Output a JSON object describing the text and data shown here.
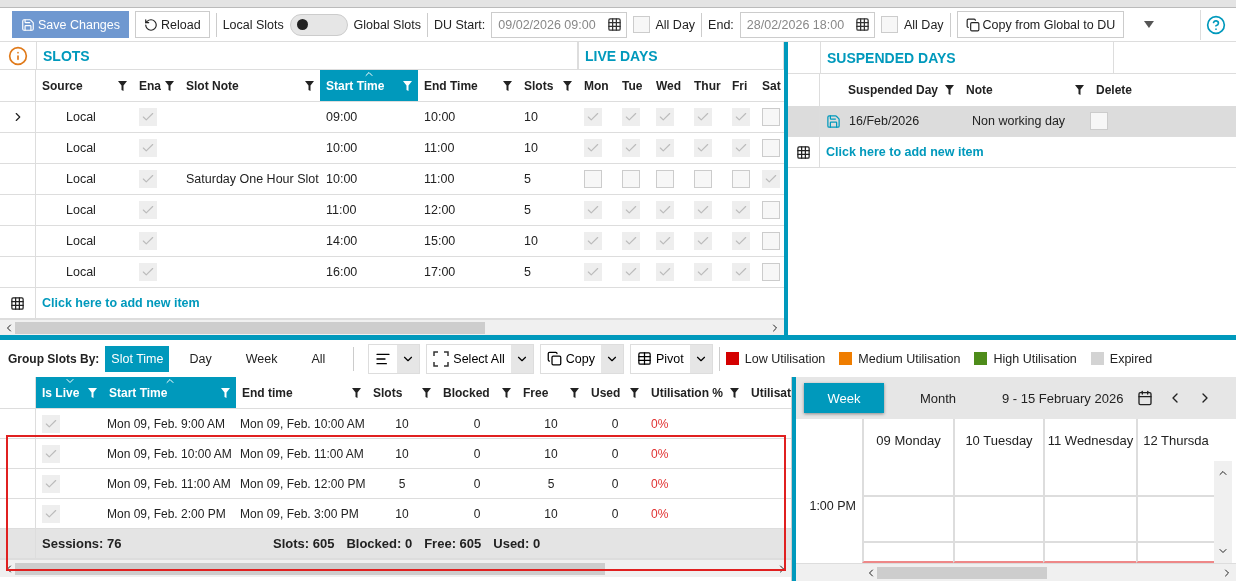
{
  "toolbar": {
    "save_button": "Save Changes",
    "reload_button": "Reload",
    "mode_toggle": {
      "left_label": "Local Slots",
      "right_label": "Global Slots",
      "on": false
    },
    "du_start": {
      "label": "DU Start:",
      "value": "09/02/2026 09:00"
    },
    "start_all_day": {
      "label": "All Day",
      "checked": false
    },
    "end": {
      "label": "End:",
      "value": "28/02/2026 18:00"
    },
    "end_all_day": {
      "label": "All Day",
      "checked": false
    },
    "copy_button": "Copy from Global to DU"
  },
  "slots": {
    "title": "SLOTS",
    "live_days_title": "LIVE DAYS",
    "columns": [
      {
        "label": "Source",
        "filter": true,
        "sorted": false
      },
      {
        "label": "Ena",
        "filter": true,
        "sorted": false
      },
      {
        "label": "Slot Note",
        "filter": true,
        "sorted": false
      },
      {
        "label": "Start Time",
        "filter": true,
        "sorted": true
      },
      {
        "label": "End Time",
        "filter": true,
        "sorted": false
      },
      {
        "label": "Slots",
        "filter": true,
        "sorted": false
      },
      {
        "label": "Mon",
        "sorted": false
      },
      {
        "label": "Tue",
        "sorted": false
      },
      {
        "label": "Wed",
        "sorted": false
      },
      {
        "label": "Thur",
        "sorted": false
      },
      {
        "label": "Fri",
        "sorted": false
      },
      {
        "label": "Sat",
        "sorted": false
      }
    ],
    "rows": [
      {
        "selected": true,
        "source": "Local",
        "enabled": true,
        "note": "",
        "start": "09:00",
        "end": "10:00",
        "slots": "10",
        "days": [
          true,
          true,
          true,
          true,
          true,
          false
        ]
      },
      {
        "selected": false,
        "source": "Local",
        "enabled": true,
        "note": "",
        "start": "10:00",
        "end": "11:00",
        "slots": "10",
        "days": [
          true,
          true,
          true,
          true,
          true,
          false
        ]
      },
      {
        "selected": false,
        "source": "Local",
        "enabled": true,
        "note": "Saturday One Hour Slot",
        "start": "10:00",
        "end": "11:00",
        "slots": "5",
        "days": [
          false,
          false,
          false,
          false,
          false,
          true
        ]
      },
      {
        "selected": false,
        "source": "Local",
        "enabled": true,
        "note": "",
        "start": "11:00",
        "end": "12:00",
        "slots": "5",
        "days": [
          true,
          true,
          true,
          true,
          true,
          false
        ]
      },
      {
        "selected": false,
        "source": "Local",
        "enabled": true,
        "note": "",
        "start": "14:00",
        "end": "15:00",
        "slots": "10",
        "days": [
          true,
          true,
          true,
          true,
          true,
          false
        ]
      },
      {
        "selected": false,
        "source": "Local",
        "enabled": true,
        "note": "",
        "start": "16:00",
        "end": "17:00",
        "slots": "5",
        "days": [
          true,
          true,
          true,
          true,
          true,
          false
        ]
      }
    ],
    "add_item": "Click here to add new item"
  },
  "suspended": {
    "title": "SUSPENDED DAYS",
    "columns": [
      {
        "label": "Suspended Day",
        "filter": true
      },
      {
        "label": "Note",
        "filter": true
      },
      {
        "label": "Delete",
        "filter": false
      }
    ],
    "rows": [
      {
        "selected": true,
        "day": "16/Feb/2026",
        "note": "Non working day",
        "delete": false
      }
    ],
    "add_item": "Click here to add new item"
  },
  "group_bar": {
    "label": "Group Slots By:",
    "options": [
      {
        "label": "Slot Time",
        "selected": true
      },
      {
        "label": "Day",
        "selected": false
      },
      {
        "label": "Week",
        "selected": false
      },
      {
        "label": "All",
        "selected": false
      }
    ],
    "buttons": [
      {
        "kind": "align"
      },
      {
        "kind": "select",
        "label": "Select All"
      },
      {
        "kind": "copy",
        "label": "Copy"
      },
      {
        "kind": "pivot",
        "label": "Pivot"
      }
    ],
    "legend": [
      {
        "label": "Low Utilisation",
        "color": "#d40000"
      },
      {
        "label": "Medium Utilisation",
        "color": "#ef7d00"
      },
      {
        "label": "High Utilisation",
        "color": "#4e8c1a"
      },
      {
        "label": "Expired",
        "color": "#d3d3d3"
      }
    ]
  },
  "sessions": {
    "columns": [
      {
        "label": "Is Live",
        "filter": true,
        "sorted": true
      },
      {
        "label": "Start Time",
        "filter": true,
        "sorted": true
      },
      {
        "label": "End time",
        "filter": true,
        "sorted": false
      },
      {
        "label": "Slots",
        "filter": true,
        "sorted": false
      },
      {
        "label": "Blocked",
        "filter": true,
        "sorted": false
      },
      {
        "label": "Free",
        "filter": true,
        "sorted": false
      },
      {
        "label": "Used",
        "filter": true,
        "sorted": false
      },
      {
        "label": "Utilisation %",
        "filter": true,
        "sorted": false
      },
      {
        "label": "Utilisat",
        "sorted": false
      }
    ],
    "rows": [
      {
        "live": true,
        "start": "Mon 09, Feb. 9:00 AM",
        "end": "Mon 09, Feb. 10:00 AM",
        "slots": "10",
        "blocked": "0",
        "free": "10",
        "used": "0",
        "utilisation": "0%"
      },
      {
        "live": true,
        "start": "Mon 09, Feb. 10:00 AM",
        "end": "Mon 09, Feb. 11:00 AM",
        "slots": "10",
        "blocked": "0",
        "free": "10",
        "used": "0",
        "utilisation": "0%"
      },
      {
        "live": true,
        "start": "Mon 09, Feb. 11:00 AM",
        "end": "Mon 09, Feb. 12:00 PM",
        "slots": "5",
        "blocked": "0",
        "free": "5",
        "used": "0",
        "utilisation": "0%"
      },
      {
        "live": true,
        "start": "Mon 09, Feb. 2:00 PM",
        "end": "Mon 09, Feb. 3:00 PM",
        "slots": "10",
        "blocked": "0",
        "free": "10",
        "used": "0",
        "utilisation": "0%"
      }
    ],
    "summary": {
      "sessions": "Sessions: 76",
      "totals": [
        "Slots: 605",
        "Blocked: 0",
        "Free: 605",
        "Used: 0"
      ]
    }
  },
  "calendar": {
    "views": [
      {
        "label": "Week",
        "selected": true
      },
      {
        "label": "Month",
        "selected": false
      }
    ],
    "range": "9  - 15 February 2026",
    "days": [
      "09 Monday",
      "10 Tuesday",
      "11 Wednesday",
      "12 Thursda"
    ],
    "times": [
      "1:00 PM"
    ]
  }
}
